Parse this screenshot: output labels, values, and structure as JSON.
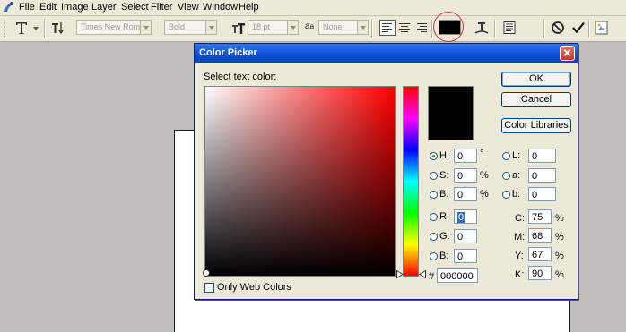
{
  "menu": [
    "File",
    "Edit",
    "Image",
    "Layer",
    "Select",
    "Filter",
    "View",
    "Window",
    "Help"
  ],
  "toolbar": {
    "font_family": "Times New Roman",
    "font_style": "Bold",
    "font_size": "18 pt",
    "antialias_icon_text": "a",
    "antialias_icon_text2": "a",
    "antialias": "None",
    "text_color": "#000000"
  },
  "dialog": {
    "title": "Color Picker",
    "select_label": "Select text color:",
    "buttons": {
      "ok": "OK",
      "cancel": "Cancel",
      "libraries": "Color Libraries"
    },
    "hsb": {
      "h_label": "H:",
      "h": "0",
      "h_unit": "°",
      "s_label": "S:",
      "s": "0",
      "s_unit": "%",
      "b_label": "B:",
      "b": "0",
      "b_unit": "%"
    },
    "lab": {
      "l_label": "L:",
      "l": "0",
      "a_label": "a:",
      "a": "0",
      "b_label": "b:",
      "b": "0"
    },
    "rgb": {
      "r_label": "R:",
      "r": "0",
      "g_label": "G:",
      "g": "0",
      "b_label": "B:",
      "b": "0"
    },
    "cmyk": {
      "c_label": "C:",
      "c": "75",
      "m_label": "M:",
      "m": "68",
      "y_label": "Y:",
      "y": "67",
      "k_label": "K:",
      "k": "90",
      "unit": "%"
    },
    "hex_label": "#",
    "hex": "000000",
    "web_colors_label": "Only Web Colors",
    "hue_selected": "H"
  }
}
